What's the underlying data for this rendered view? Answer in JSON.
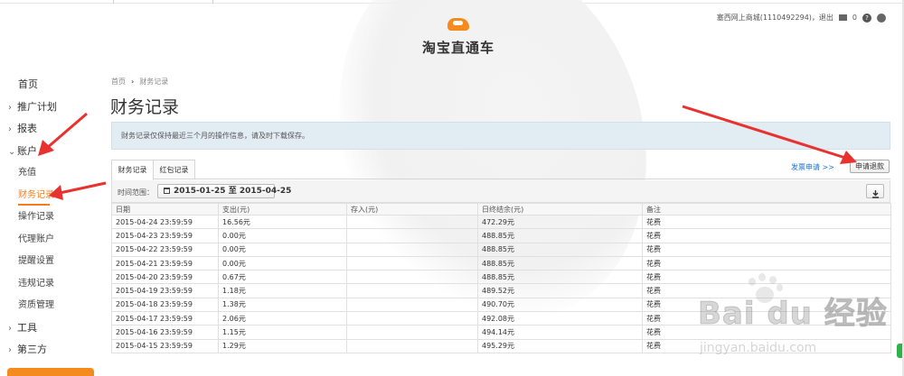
{
  "header": {
    "logo_text": "淘宝直通车",
    "account": "塞西网上商城(1110492294)，退出",
    "mail_count": "0",
    "help_glyph": "?",
    "colors": {
      "brand_orange": "#f58a1f",
      "active_orange": "#f57c1f",
      "link_blue": "#1a73c8",
      "info_bar": "#e2ecf3",
      "annotation_red": "#e8322f"
    },
    "icons": [
      "mail-icon",
      "help-icon",
      "fire-icon"
    ]
  },
  "sidebar": {
    "items": [
      {
        "label": "首页",
        "type": "top"
      },
      {
        "label": "推广计划",
        "type": "parent",
        "chevron": "›"
      },
      {
        "label": "报表",
        "type": "parent",
        "chevron": "›"
      },
      {
        "label": "账户",
        "type": "parent",
        "chevron": "⌄"
      },
      {
        "label": "充值",
        "type": "sub"
      },
      {
        "label": "财务记录",
        "type": "sub",
        "active": true
      },
      {
        "label": "操作记录",
        "type": "sub"
      },
      {
        "label": "代理账户",
        "type": "sub"
      },
      {
        "label": "提醒设置",
        "type": "sub"
      },
      {
        "label": "违规记录",
        "type": "sub"
      },
      {
        "label": "资质管理",
        "type": "sub"
      },
      {
        "label": "工具",
        "type": "parent",
        "chevron": "›"
      },
      {
        "label": "第三方",
        "type": "parent",
        "chevron": "›"
      }
    ]
  },
  "main": {
    "breadcrumb": {
      "home": "首页",
      "current": "财务记录"
    },
    "title": "财务记录",
    "notice": "财务记录仅保持最近三个月的操作信息，请及时下载保存。",
    "tabs": [
      {
        "label": "财务记录",
        "active": true
      },
      {
        "label": "红包记录",
        "active": false
      }
    ],
    "invoice_link": "发票申请 >>",
    "refund_button": "申请退款",
    "filter": {
      "label": "时间范围：",
      "date_range": "2015-01-25 至 2015-04-25"
    },
    "table": {
      "columns": [
        "日期",
        "支出(元)",
        "存入(元)",
        "日终结余(元)",
        "备注"
      ],
      "rows": [
        [
          "2015-04-24 23:59:59",
          "16.56元",
          "",
          "472.29元",
          "花费"
        ],
        [
          "2015-04-23 23:59:59",
          "0.00元",
          "",
          "488.85元",
          "花费"
        ],
        [
          "2015-04-22 23:59:59",
          "0.00元",
          "",
          "488.85元",
          "花费"
        ],
        [
          "2015-04-21 23:59:59",
          "0.00元",
          "",
          "488.85元",
          "花费"
        ],
        [
          "2015-04-20 23:59:59",
          "0.67元",
          "",
          "488.85元",
          "花费"
        ],
        [
          "2015-04-19 23:59:59",
          "1.18元",
          "",
          "489.52元",
          "花费"
        ],
        [
          "2015-04-18 23:59:59",
          "1.38元",
          "",
          "490.70元",
          "花费"
        ],
        [
          "2015-04-17 23:59:59",
          "2.06元",
          "",
          "492.08元",
          "花费"
        ],
        [
          "2015-04-16 23:59:59",
          "1.15元",
          "",
          "494.14元",
          "花费"
        ],
        [
          "2015-04-15 23:59:59",
          "1.29元",
          "",
          "495.29元",
          "花费"
        ]
      ]
    }
  },
  "watermark": {
    "brand": "Bai du 经验",
    "url": "jingyan.baidu.com"
  }
}
